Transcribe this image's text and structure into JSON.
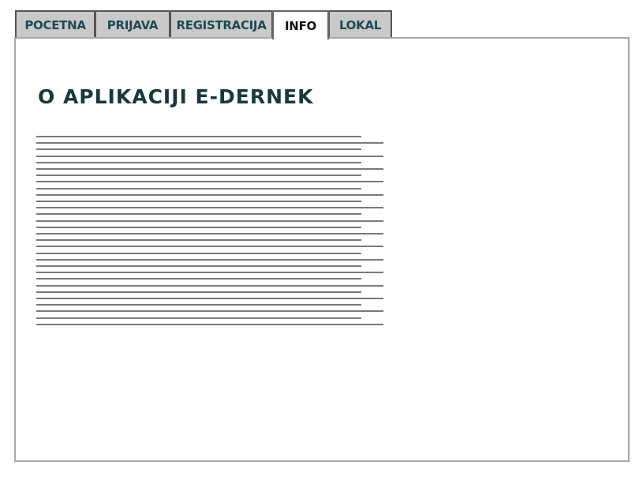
{
  "tabs": [
    {
      "label": "POCETNA",
      "active": false
    },
    {
      "label": "PRIJAVA",
      "active": false
    },
    {
      "label": "REGISTRACIJA",
      "active": false
    },
    {
      "label": "INFO",
      "active": true
    },
    {
      "label": "LOKAL",
      "active": false
    }
  ],
  "content": {
    "title": "O APLIKACIJI E-DERNEK",
    "body_placeholder": "text lines"
  },
  "colors": {
    "tab_background": "#c9c9c9",
    "tab_text": "#1e4a52",
    "active_tab_background": "#ffffff",
    "title_text": "#17383e",
    "panel_border": "#a9a9a9",
    "placeholder_line": "#7a7a7a"
  }
}
